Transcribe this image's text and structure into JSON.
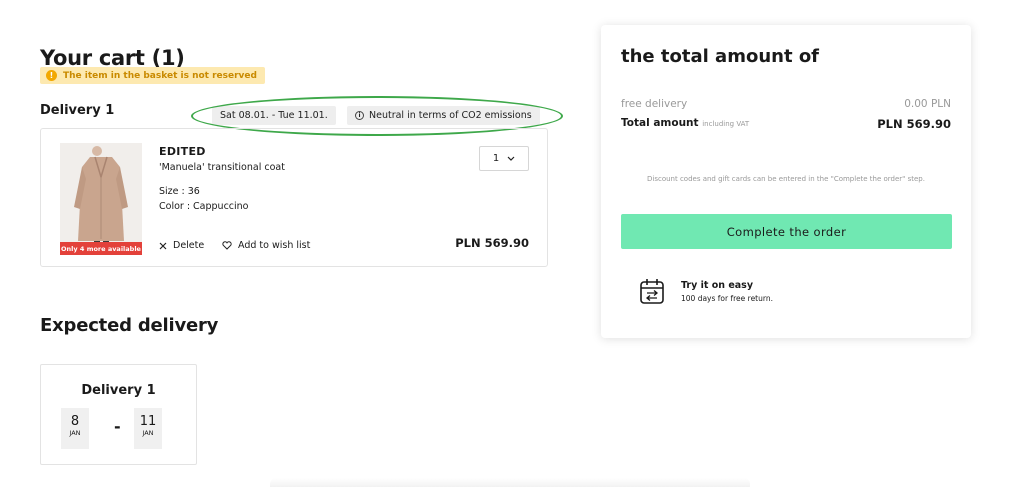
{
  "cart": {
    "title": "Your cart (1)",
    "reserve_warning": "The item in the basket is not reserved",
    "warning_icon": "!",
    "delivery_label": "Delivery 1",
    "delivery_dates": "Sat 08.01. - Tue 11.01.",
    "co2_note": "Neutral in terms of CO2 emissions",
    "info_icon": "i",
    "item": {
      "brand": "EDITED",
      "name": "'Manuela' transitional coat",
      "size": "Size : 36",
      "color": "Color : Cappuccino",
      "stock_badge": "Only 4 more available",
      "quantity": "1",
      "delete_label": "Delete",
      "wishlist_label": "Add to wish list",
      "price": "PLN 569.90",
      "image_color": "#c9a58e"
    }
  },
  "expected": {
    "title": "Expected delivery",
    "delivery_label": "Delivery 1",
    "from_day": "8",
    "from_month": "JAN",
    "separator": "-",
    "to_day": "11",
    "to_month": "JAN"
  },
  "summary": {
    "title": "the total amount of",
    "free_delivery_label": "free delivery",
    "free_delivery_value": "0.00 PLN",
    "total_label": "Total amount",
    "vat_note": "including VAT",
    "total_value": "PLN 569.90",
    "discount_note": "Discount codes and gift cards can be entered in the \"Complete the order\" step.",
    "complete_button": "Complete the order",
    "easy_title": "Try it on easy",
    "easy_subtitle": "100 days for free return."
  },
  "colors": {
    "accent_button": "#70e8b2",
    "highlight_ring": "#3ea84a",
    "warning_bg": "#fde9b0",
    "stock_badge": "#e3413a"
  },
  "icons": {
    "close": "close-icon",
    "heart": "heart-icon",
    "chevron": "chevron-down-icon",
    "calendar_return": "calendar-return-icon"
  }
}
